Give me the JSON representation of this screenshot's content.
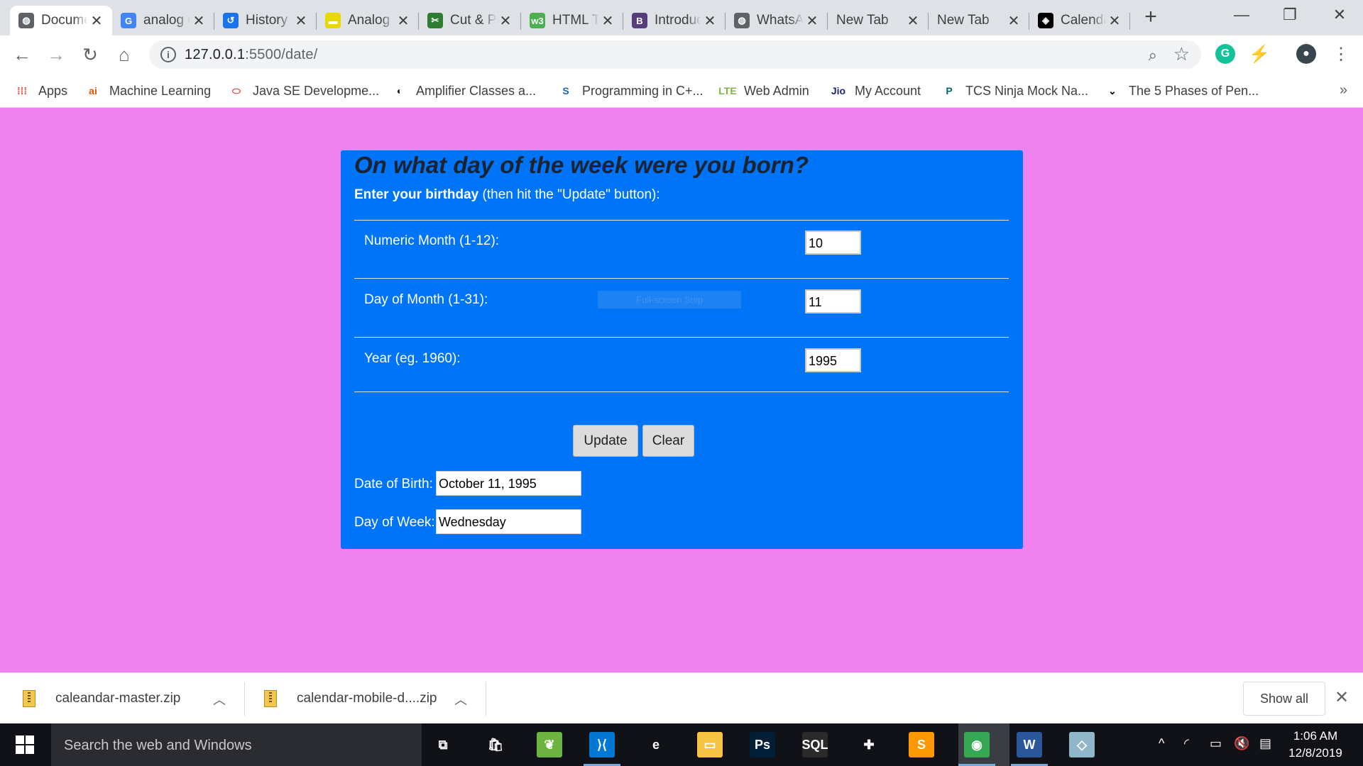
{
  "tabs": [
    {
      "title": "Document",
      "icon": "globe-icon",
      "icon_char": "◍",
      "icon_bg": "#5f6368",
      "active": true
    },
    {
      "title": "analog clock",
      "icon": "google-icon",
      "icon_char": "G",
      "icon_bg": "#4285f4"
    },
    {
      "title": "History",
      "icon": "history-icon",
      "icon_char": "↺",
      "icon_bg": "#1a73e8"
    },
    {
      "title": "Analog Clock",
      "icon": "codepen-yellow-icon",
      "icon_char": "▬",
      "icon_bg": "#e6d800"
    },
    {
      "title": "Cut & Paste",
      "icon": "scissors-icon",
      "icon_char": "✂",
      "icon_bg": "#2e7d32"
    },
    {
      "title": "HTML Tutorial",
      "icon": "w3schools-icon",
      "icon_char": "w3",
      "icon_bg": "#4caf50"
    },
    {
      "title": "Introduction",
      "icon": "bootstrap-icon",
      "icon_char": "B",
      "icon_bg": "#563d7c"
    },
    {
      "title": "WhatsApp",
      "icon": "globe-icon",
      "icon_char": "◍",
      "icon_bg": "#5f6368"
    },
    {
      "title": "New Tab",
      "icon": "",
      "icon_char": "",
      "icon_bg": ""
    },
    {
      "title": "New Tab",
      "icon": "",
      "icon_char": "",
      "icon_bg": ""
    },
    {
      "title": "Calendar",
      "icon": "codepen-icon",
      "icon_char": "◈",
      "icon_bg": "#000000"
    }
  ],
  "toolbar": {
    "url_host": "127.0.0.1",
    "url_path": ":5500/date/"
  },
  "bookmarks": [
    {
      "label": "Apps",
      "icon": "apps-grid-icon",
      "icon_char": "⁞⁞⁞",
      "color": "#ea4335"
    },
    {
      "label": "Machine Learning",
      "icon": "ai-logo-icon",
      "icon_char": "ai",
      "color": "#e65100"
    },
    {
      "label": "Java SE Developme...",
      "icon": "oracle-icon",
      "icon_char": "⬭",
      "color": "#e53935"
    },
    {
      "label": "Amplifier Classes a...",
      "icon": "amplifier-icon",
      "icon_char": "◐",
      "color": "#222222"
    },
    {
      "label": "Programming in C+...",
      "icon": "s-logo-icon",
      "icon_char": "S",
      "color": "#1565c0"
    },
    {
      "label": "Web Admin",
      "icon": "lte-icon",
      "icon_char": "LTE",
      "color": "#7cb342"
    },
    {
      "label": "My Account",
      "icon": "jio-icon",
      "icon_char": "Jio",
      "color": "#1a237e"
    },
    {
      "label": "TCS Ninja Mock Na...",
      "icon": "prepinsta-icon",
      "icon_char": "P",
      "color": "#00695c"
    },
    {
      "label": "The 5 Phases of Pen...",
      "icon": "bird-icon",
      "icon_char": "⌄",
      "color": "#000000"
    }
  ],
  "page": {
    "heading": "On what day of the week were you born?",
    "instructions_bold": "Enter your birthday",
    "instructions_rest": " (then hit the \"Update\" button):",
    "fields": [
      {
        "label": "Numeric Month (1-12):",
        "value": "10"
      },
      {
        "label": "Day of Month (1-31):",
        "value": "11"
      },
      {
        "label": "Year (eg. 1960):",
        "value": "1995"
      }
    ],
    "snip_hint": "Full-screen Snip",
    "update_label": "Update",
    "clear_label": "Clear",
    "dob_label": "Date of Birth:",
    "dob_value": "October 11, 1995",
    "dow_label": "Day of Week:",
    "dow_value": "Wednesday"
  },
  "downloads": {
    "items": [
      "caleandar-master.zip",
      "calendar-mobile-d....zip"
    ],
    "show_all": "Show all"
  },
  "taskbar": {
    "search_placeholder": "Search the web and Windows",
    "apps": [
      {
        "name": "task-view-icon",
        "char": "⧉",
        "bg": "transparent"
      },
      {
        "name": "store-icon",
        "char": "🛍",
        "bg": "transparent"
      },
      {
        "name": "spring-tool-icon",
        "char": "❦",
        "bg": "#6db33f"
      },
      {
        "name": "vscode-icon",
        "char": "⟩⟨",
        "bg": "#0078d4",
        "running": true
      },
      {
        "name": "edge-icon",
        "char": "e",
        "bg": "transparent"
      },
      {
        "name": "file-explorer-icon",
        "char": "▭",
        "bg": "#f6c342"
      },
      {
        "name": "photoshop-icon",
        "char": "Ps",
        "bg": "#001e36"
      },
      {
        "name": "mysql-icon",
        "char": "SQL",
        "bg": "#2a2a2a"
      },
      {
        "name": "game-icon",
        "char": "✚",
        "bg": "transparent"
      },
      {
        "name": "sublime-icon",
        "char": "S",
        "bg": "#ff9800"
      },
      {
        "name": "chrome-icon",
        "char": "◉",
        "bg": "#34a853",
        "running": true
      },
      {
        "name": "word-icon",
        "char": "W",
        "bg": "#2b579a",
        "running": true
      },
      {
        "name": "notes-icon",
        "char": "◇",
        "bg": "#8fb7c9"
      }
    ],
    "time": "1:06 AM",
    "date": "12/8/2019"
  }
}
